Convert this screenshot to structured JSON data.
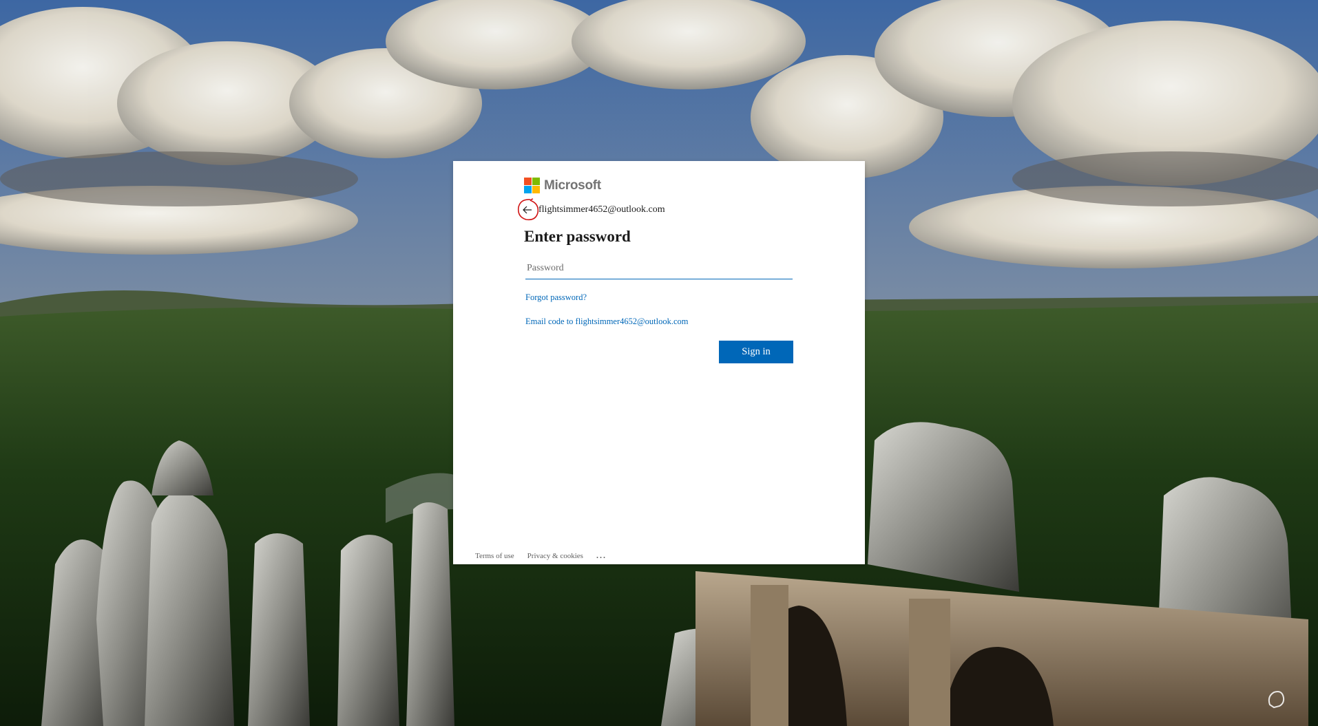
{
  "brand": {
    "name": "Microsoft",
    "logo_colors": [
      "#f25022",
      "#7fba00",
      "#00a4ef",
      "#ffb900"
    ],
    "logo_icon": "microsoft-logo"
  },
  "identity": {
    "back_icon": "arrow-left-icon",
    "email": "flightsimmer4652@outlook.com"
  },
  "form": {
    "title": "Enter password",
    "password_placeholder": "Password",
    "password_value": "",
    "forgot_link": "Forgot password?",
    "email_code_link": "Email code to flightsimmer4652@outlook.com",
    "signin_label": "Sign in"
  },
  "footer": {
    "terms": "Terms of use",
    "privacy": "Privacy & cookies",
    "more": "..."
  },
  "colors": {
    "accent": "#0067b8",
    "annotation": "#d01515"
  },
  "accessibility_icon": "accessibility-icon"
}
